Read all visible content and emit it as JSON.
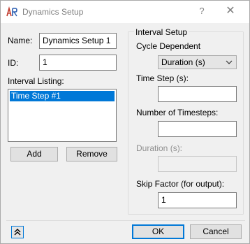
{
  "window": {
    "title": "Dynamics Setup",
    "help_glyph": "?",
    "close_glyph": "✕"
  },
  "form": {
    "name_label": "Name:",
    "name_value": "Dynamics Setup 1",
    "id_label": "ID:",
    "id_value": "1",
    "interval_listing_label": "Interval Listing:",
    "interval_items": [
      "Time Step #1"
    ],
    "add_label": "Add",
    "remove_label": "Remove"
  },
  "interval_setup": {
    "group_title": "Interval Setup",
    "cycle_label": "Cycle Dependent",
    "cycle_selected": "Duration (s)",
    "time_step_label": "Time Step (s):",
    "time_step_value": "",
    "num_timesteps_label": "Number of Timesteps:",
    "num_timesteps_value": "",
    "duration_label": "Duration (s):",
    "duration_value": "",
    "skip_factor_label": "Skip Factor (for output):",
    "skip_factor_value": "1"
  },
  "footer": {
    "ok_label": "OK",
    "cancel_label": "Cancel"
  },
  "colors": {
    "selection": "#0078d7",
    "disabled_text": "#909090"
  }
}
